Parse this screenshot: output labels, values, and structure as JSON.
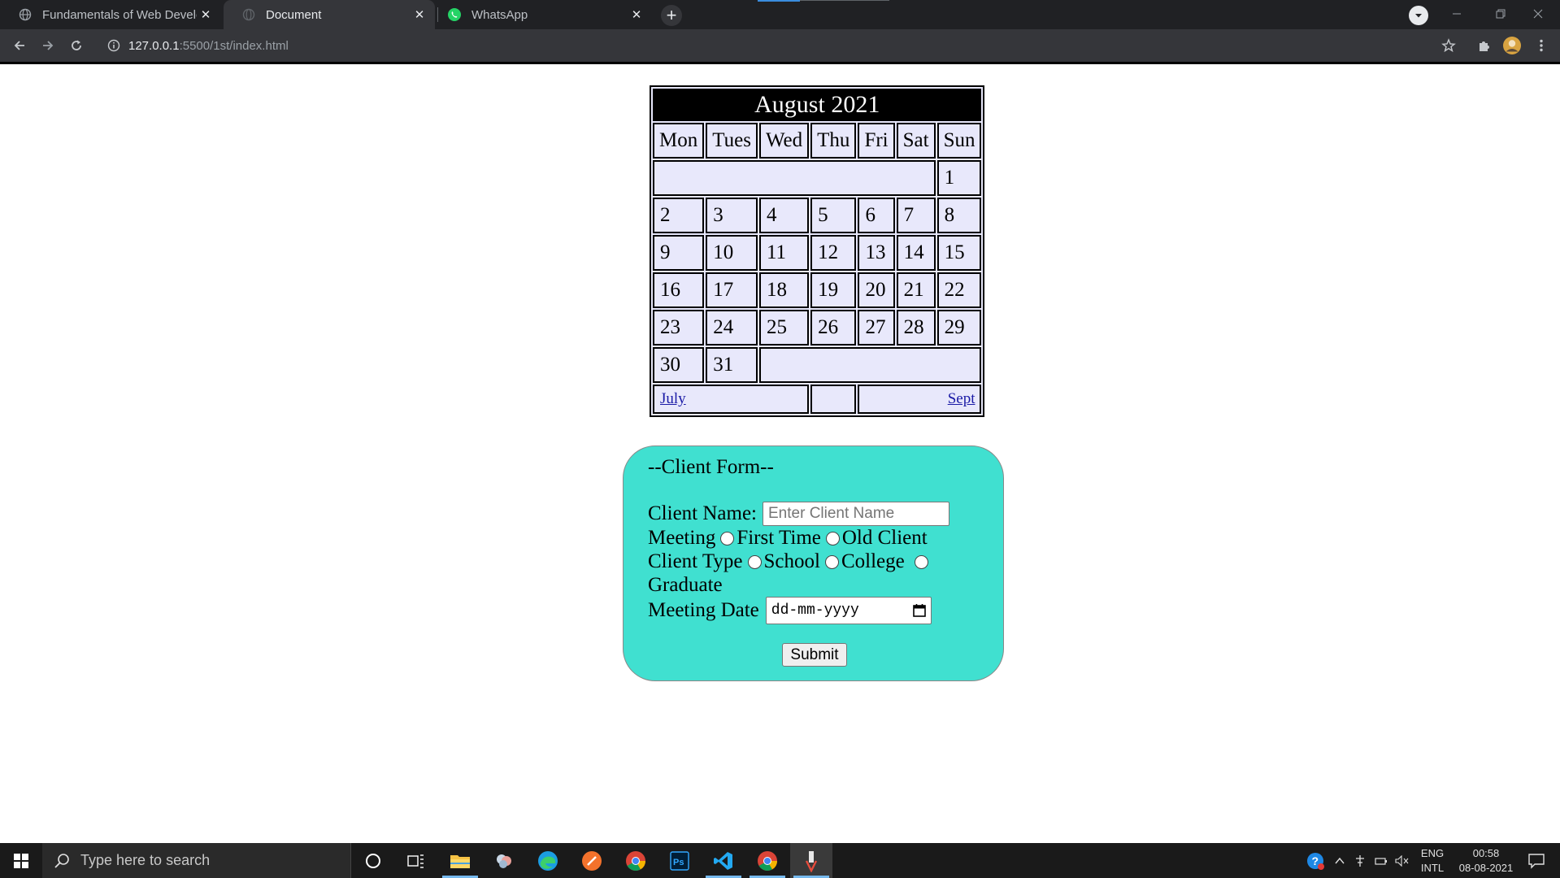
{
  "browser": {
    "tabs": [
      {
        "title": "Fundamentals of Web Developm",
        "favicon": "globe-icon",
        "active": false
      },
      {
        "title": "Document",
        "favicon": "globe-icon",
        "active": true
      },
      {
        "title": "WhatsApp",
        "favicon": "whatsapp-icon",
        "active": false
      }
    ],
    "address": {
      "host": "127.0.0.1",
      "rest": ":5500/1st/index.html"
    }
  },
  "calendar": {
    "title": "August 2021",
    "days": [
      "Mon",
      "Tues",
      "Wed",
      "Thu",
      "Fri",
      "Sat",
      "Sun"
    ],
    "weeks": [
      [
        "",
        "",
        "",
        "",
        "",
        "",
        "1"
      ],
      [
        "2",
        "3",
        "4",
        "5",
        "6",
        "7",
        "8"
      ],
      [
        "9",
        "10",
        "11",
        "12",
        "13",
        "14",
        "15"
      ],
      [
        "16",
        "17",
        "18",
        "19",
        "20",
        "21",
        "22"
      ],
      [
        "23",
        "24",
        "25",
        "26",
        "27",
        "28",
        "29"
      ],
      [
        "30",
        "31",
        "",
        "",
        "",
        "",
        ""
      ]
    ],
    "prev_link": "July",
    "next_link": "Sept"
  },
  "form": {
    "legend": "--Client Form--",
    "name_label": "Client Name:",
    "name_placeholder": "Enter Client Name",
    "meeting_label": "Meeting",
    "meeting_options": [
      "First Time",
      "Old Client"
    ],
    "client_type_label": "Client Type",
    "client_type_options": [
      "School",
      "College",
      "Graduate"
    ],
    "date_label": "Meeting Date",
    "date_placeholder": "dd-mm-yyyy",
    "submit_label": "Submit"
  },
  "taskbar": {
    "search_placeholder": "Type here to search",
    "lang_top": "ENG",
    "lang_bottom": "INTL",
    "time": "00:58",
    "date": "08-08-2021"
  },
  "colors": {
    "form_bg": "#40e0d0",
    "calendar_bg": "#e8e8fb",
    "chrome_dark": "#202124",
    "chrome_toolbar": "#35363a"
  }
}
